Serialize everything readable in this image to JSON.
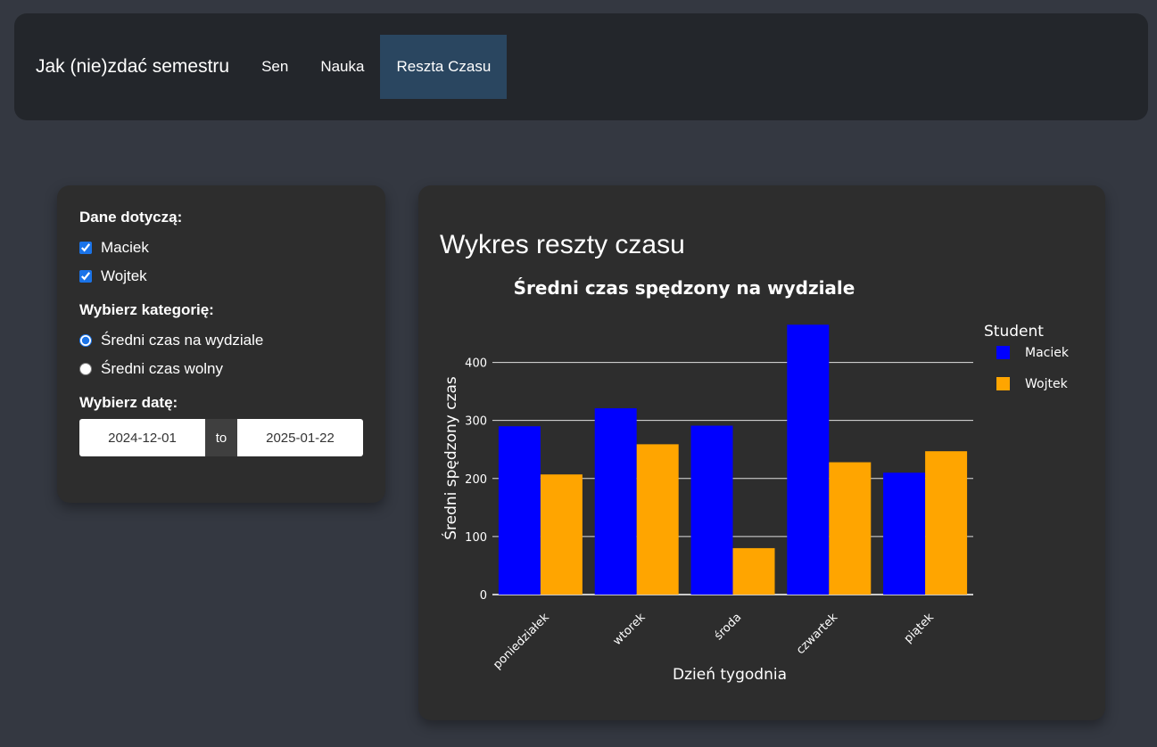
{
  "nav": {
    "brand": "Jak (nie)zdać semestru",
    "links": [
      {
        "label": "Sen",
        "active": false
      },
      {
        "label": "Nauka",
        "active": false
      },
      {
        "label": "Reszta Czasu",
        "active": true
      }
    ]
  },
  "sidebar": {
    "data_label": "Dane dotyczą:",
    "students": [
      {
        "label": "Maciek",
        "checked": true
      },
      {
        "label": "Wojtek",
        "checked": true
      }
    ],
    "category_label": "Wybierz kategorię:",
    "categories": [
      {
        "label": "Średni czas na wydziale",
        "selected": true
      },
      {
        "label": "Średni czas wolny",
        "selected": false
      }
    ],
    "date_label": "Wybierz datę:",
    "date_start": "2024-12-01",
    "date_sep": "to",
    "date_end": "2025-01-22"
  },
  "card": {
    "title": "Wykres reszty czasu"
  },
  "chart_data": {
    "type": "bar",
    "title": "Średni czas spędzony na wydziale",
    "xlabel": "Dzień tygodnia",
    "ylabel": "Średni spędzony czas",
    "categories": [
      "poniedziałek",
      "wtorek",
      "środa",
      "czwartek",
      "piątek"
    ],
    "series": [
      {
        "name": "Maciek",
        "color": "#0000ff",
        "values": [
          290,
          321,
          291,
          465,
          210
        ]
      },
      {
        "name": "Wojtek",
        "color": "#ffa500",
        "values": [
          207,
          259,
          80,
          228,
          247
        ]
      }
    ],
    "yticks": [
      0,
      100,
      200,
      300,
      400
    ],
    "ylim": [
      0,
      470
    ],
    "legend_title": "Student",
    "legend_position": "top-right",
    "grid": true
  }
}
